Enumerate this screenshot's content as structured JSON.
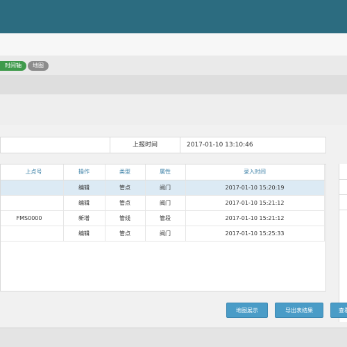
{
  "tags": [
    "时间轴",
    "地图"
  ],
  "info": {
    "label": "上报时间",
    "value": "2017-01-10 13:10:46"
  },
  "table": {
    "headers": [
      "上点号",
      "操作",
      "类型",
      "属性",
      "录入时间"
    ],
    "rows": [
      [
        "",
        "编辑",
        "管点",
        "阀门",
        "2017-01-10 15:20:19"
      ],
      [
        "",
        "编辑",
        "管点",
        "阀门",
        "2017-01-10 15:21:12"
      ],
      [
        "FMS0000",
        "新增",
        "管线",
        "管段",
        "2017-01-10 15:21:12"
      ],
      [
        "",
        "编辑",
        "管点",
        "阀门",
        "2017-01-10 15:25:33"
      ]
    ]
  },
  "buttons": [
    "地图展示",
    "导出表结果",
    "查看"
  ]
}
